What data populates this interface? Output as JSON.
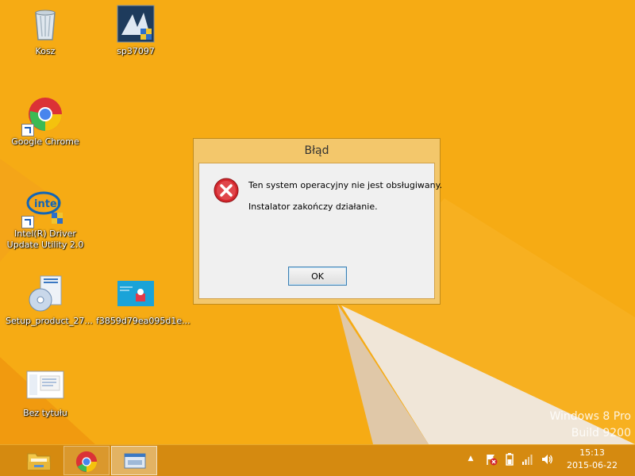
{
  "desktop": {
    "icons": [
      {
        "label": "Kosz",
        "icon": "recycle-bin-icon"
      },
      {
        "label": "sp37097",
        "icon": "installer-icon"
      },
      {
        "label": "Google Chrome",
        "icon": "chrome-icon"
      },
      {
        "label": "Intel(R) Driver",
        "label2": "Update Utility 2.0",
        "icon": "intel-icon"
      },
      {
        "label": "Setup_product_27...",
        "icon": "setup-icon"
      },
      {
        "label": "f3859d79ea095d1e...",
        "icon": "image-thumbnail-icon"
      },
      {
        "label": "Bez tytułu",
        "icon": "document-icon"
      }
    ],
    "watermark": {
      "line1": "Windows 8 Pro",
      "line2": "Build 9200"
    }
  },
  "dialog": {
    "title": "Błąd",
    "message_line1": "Ten system operacyjny nie jest obsługiwany.",
    "message_line2": "Instalator zakończy działanie.",
    "ok_label": "OK",
    "icon": "error-icon"
  },
  "taskbar": {
    "buttons": [
      {
        "name": "file-explorer",
        "icon": "folder-icon"
      },
      {
        "name": "google-chrome",
        "icon": "chrome-icon"
      },
      {
        "name": "installer",
        "icon": "installer-window-icon"
      }
    ],
    "tray": {
      "chevron": "▲",
      "icons": [
        "action-center-flag-icon",
        "power-icon",
        "network-signal-icon",
        "volume-icon"
      ]
    },
    "clock": {
      "time": "15:13",
      "date": "2015-06-22"
    }
  },
  "colors": {
    "desktop_background": "#f5a712",
    "taskbar": "#d58a10",
    "dialog_frame": "#f3c76b",
    "error_red": "#d3262c"
  }
}
